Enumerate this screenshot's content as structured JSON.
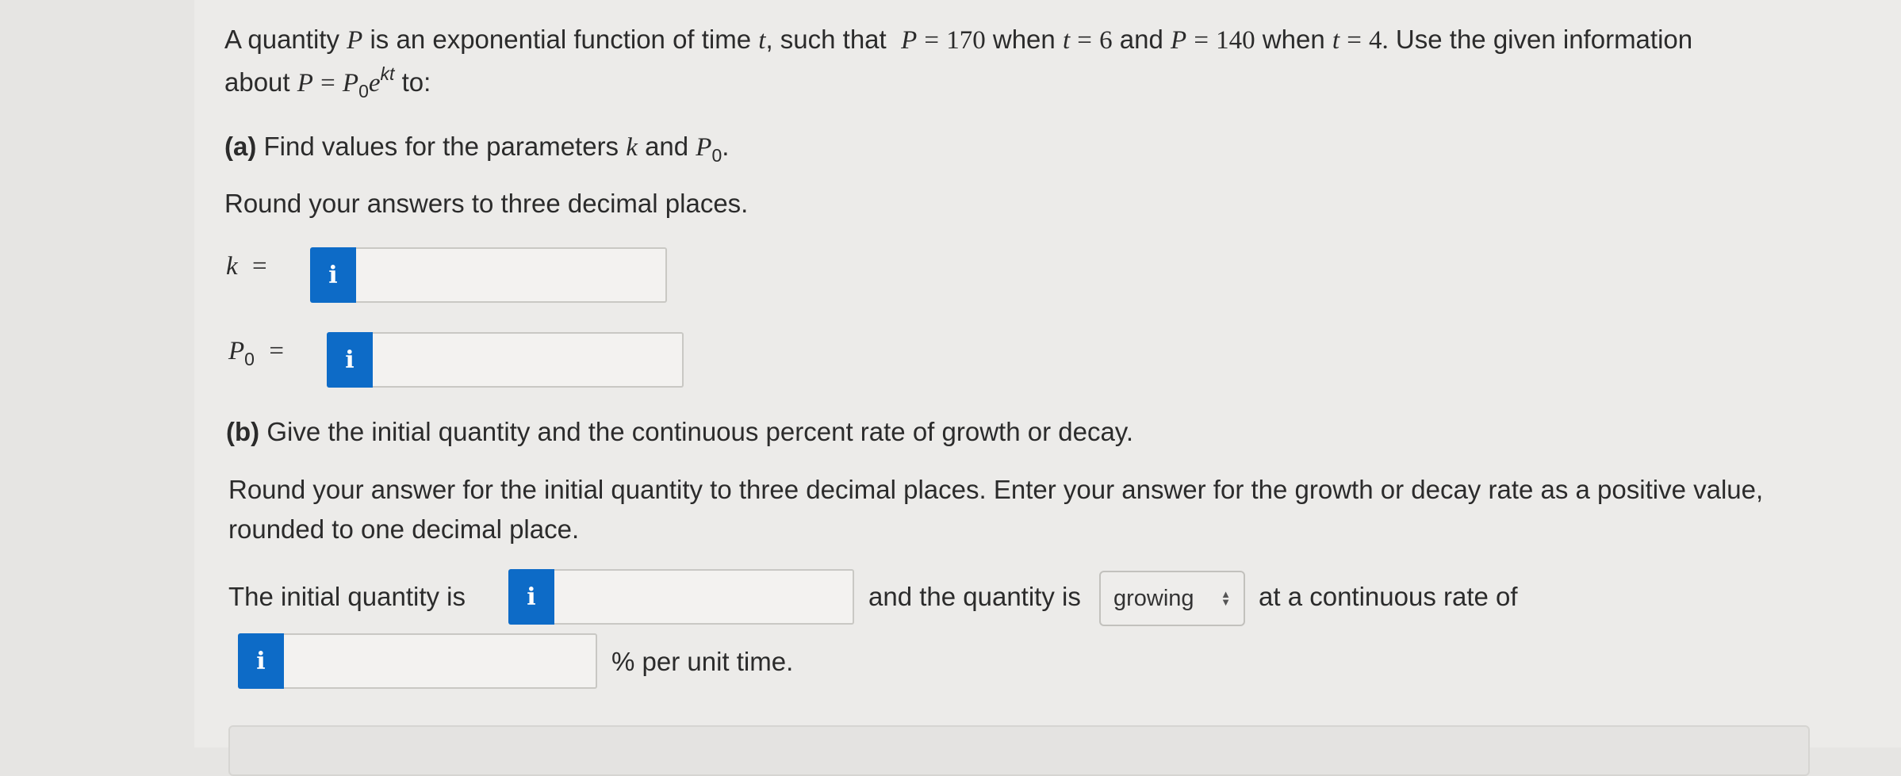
{
  "problem": {
    "intro_prefix": "A quantity",
    "var_P": "P",
    "intro_mid1": "is an exponential function of time",
    "var_t": "t",
    "intro_mid2": ", such that",
    "cond1_lhs": "P",
    "eq": "=",
    "cond1_val": "170",
    "when1": "when",
    "cond1_t": "t",
    "cond1_tval": "6",
    "and1": "and",
    "cond2_lhs": "P",
    "cond2_val": "140",
    "when2": "when",
    "cond2_t": "t",
    "cond2_tval": "4.",
    "use_info": "Use the given information",
    "about": "about",
    "model_P": "P",
    "model_P0": "P",
    "model_sub": "0",
    "model_e": "e",
    "model_exp": "kt",
    "to": "to:"
  },
  "part_a": {
    "label": "(a)",
    "text_prefix": "Find values for the parameters",
    "var_k": "k",
    "text_and": "and",
    "var_P0": "P",
    "var_P0_sub": "0",
    "period": ".",
    "round_text": "Round your answers to three decimal places.",
    "k_label": "k",
    "P0_label": "P",
    "P0_sub": "0",
    "eq": "=",
    "k_value": "",
    "P0_value": ""
  },
  "part_b": {
    "label": "(b)",
    "text": "Give the initial quantity and the continuous percent rate of growth or decay.",
    "round_line1": "Round your answer for the initial quantity to three decimal places. Enter your answer for the growth or decay rate as a positive value,",
    "round_line2": "rounded to one decimal place.",
    "initial_prefix": "The initial quantity is",
    "initial_value": "",
    "and_quantity_is": "and the quantity is",
    "select_value": "growing",
    "rate_suffix": "at a continuous rate of",
    "rate_value": "",
    "per_unit": "% per unit time."
  },
  "icons": {
    "info_glyph": "i"
  }
}
